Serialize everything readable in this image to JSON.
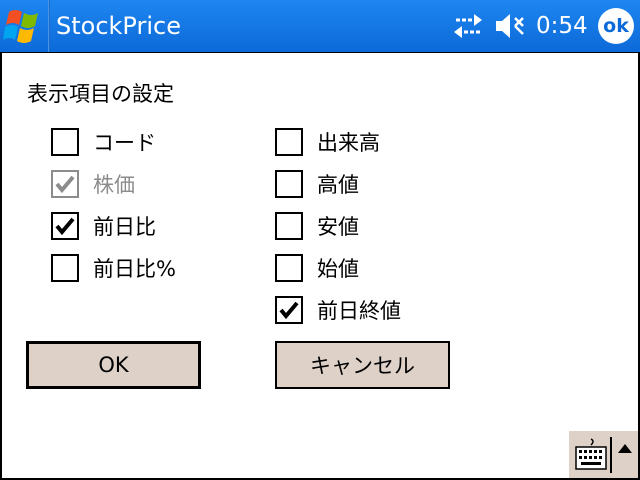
{
  "titlebar": {
    "app_title": "StockPrice",
    "clock": "0:54",
    "ok_label": "ok",
    "icons": [
      "windows-start-icon",
      "connectivity-arrows-icon",
      "speaker-muted-icon"
    ]
  },
  "dialog": {
    "section_title": "表示項目の設定",
    "left_column": [
      {
        "label": "コード",
        "checked": false,
        "disabled": false
      },
      {
        "label": "株価",
        "checked": true,
        "disabled": true
      },
      {
        "label": "前日比",
        "checked": true,
        "disabled": false
      },
      {
        "label": "前日比%",
        "checked": false,
        "disabled": false
      }
    ],
    "right_column": [
      {
        "label": "出来高",
        "checked": false,
        "disabled": false
      },
      {
        "label": "高値",
        "checked": false,
        "disabled": false
      },
      {
        "label": "安値",
        "checked": false,
        "disabled": false
      },
      {
        "label": "始値",
        "checked": false,
        "disabled": false
      },
      {
        "label": "前日終値",
        "checked": true,
        "disabled": false
      }
    ],
    "ok_button": "OK",
    "cancel_button": "キャンセル"
  },
  "colors": {
    "titlebar": "#0c6ad8",
    "button_face": "#ddd1c8",
    "disabled_text": "#8c8c8c"
  }
}
